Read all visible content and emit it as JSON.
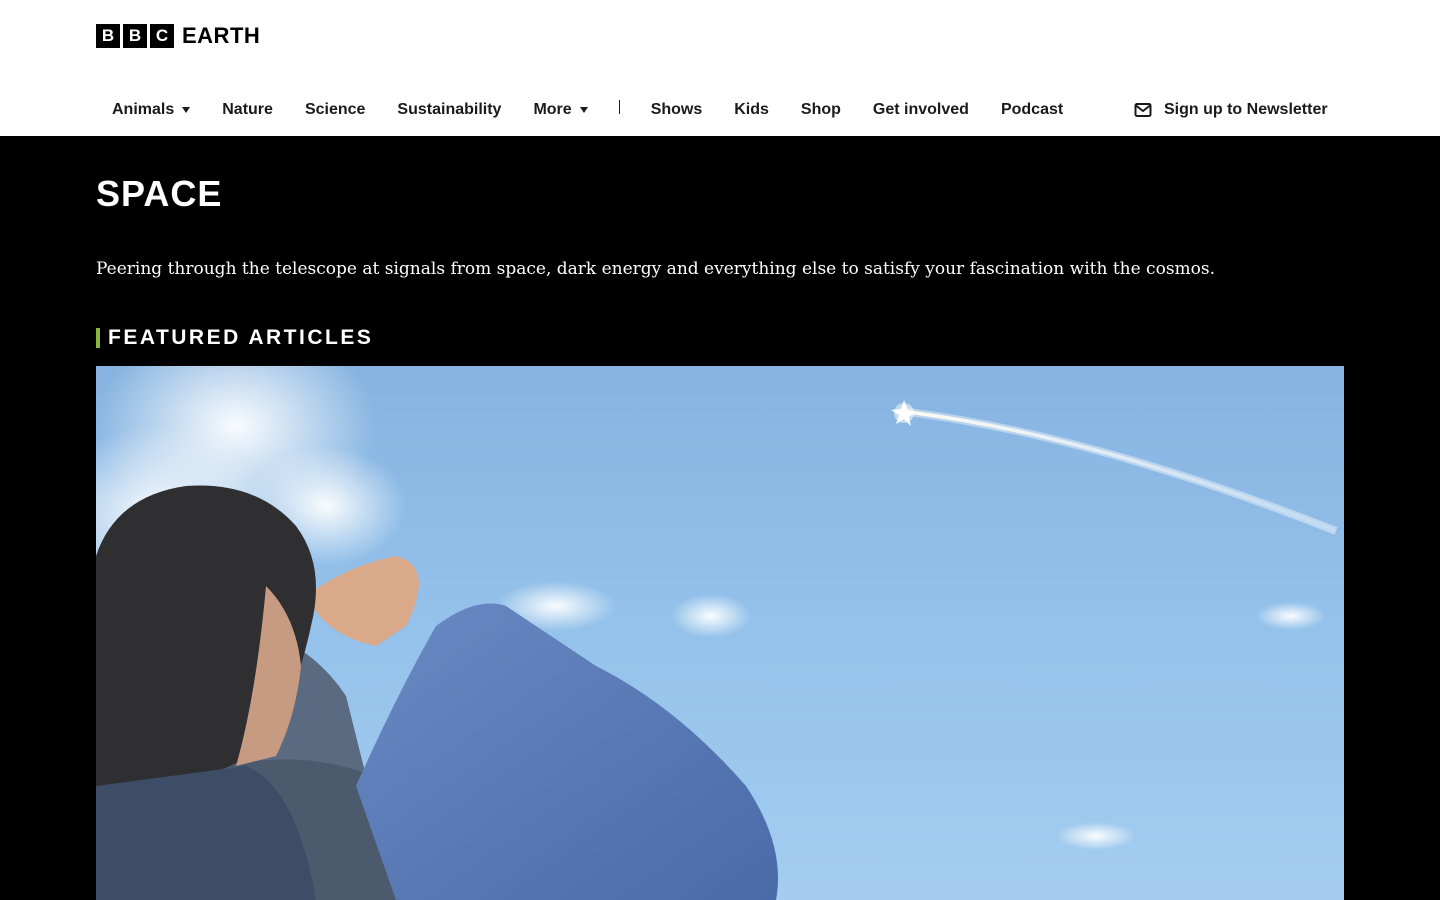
{
  "brand": {
    "blocks": [
      "B",
      "B",
      "C"
    ],
    "name": "EARTH"
  },
  "nav": {
    "animals": "Animals",
    "nature": "Nature",
    "science": "Science",
    "sustainability": "Sustainability",
    "more": "More",
    "shows": "Shows",
    "kids": "Kids",
    "shop": "Shop",
    "get_involved": "Get involved",
    "podcast": "Podcast"
  },
  "newsletter": {
    "icon": "envelope-icon",
    "label": "Sign up to Newsletter"
  },
  "page": {
    "title": "SPACE",
    "description": "Peering through the telescope at signals from space, dark energy and everything else to satisfy your fascination with the cosmos."
  },
  "featured": {
    "heading": "FEATURED ARTICLES",
    "accent_color": "#8db43a"
  },
  "colors": {
    "header_bg": "#ffffff",
    "body_bg": "#000000",
    "text_dark": "#1a1a1a"
  }
}
